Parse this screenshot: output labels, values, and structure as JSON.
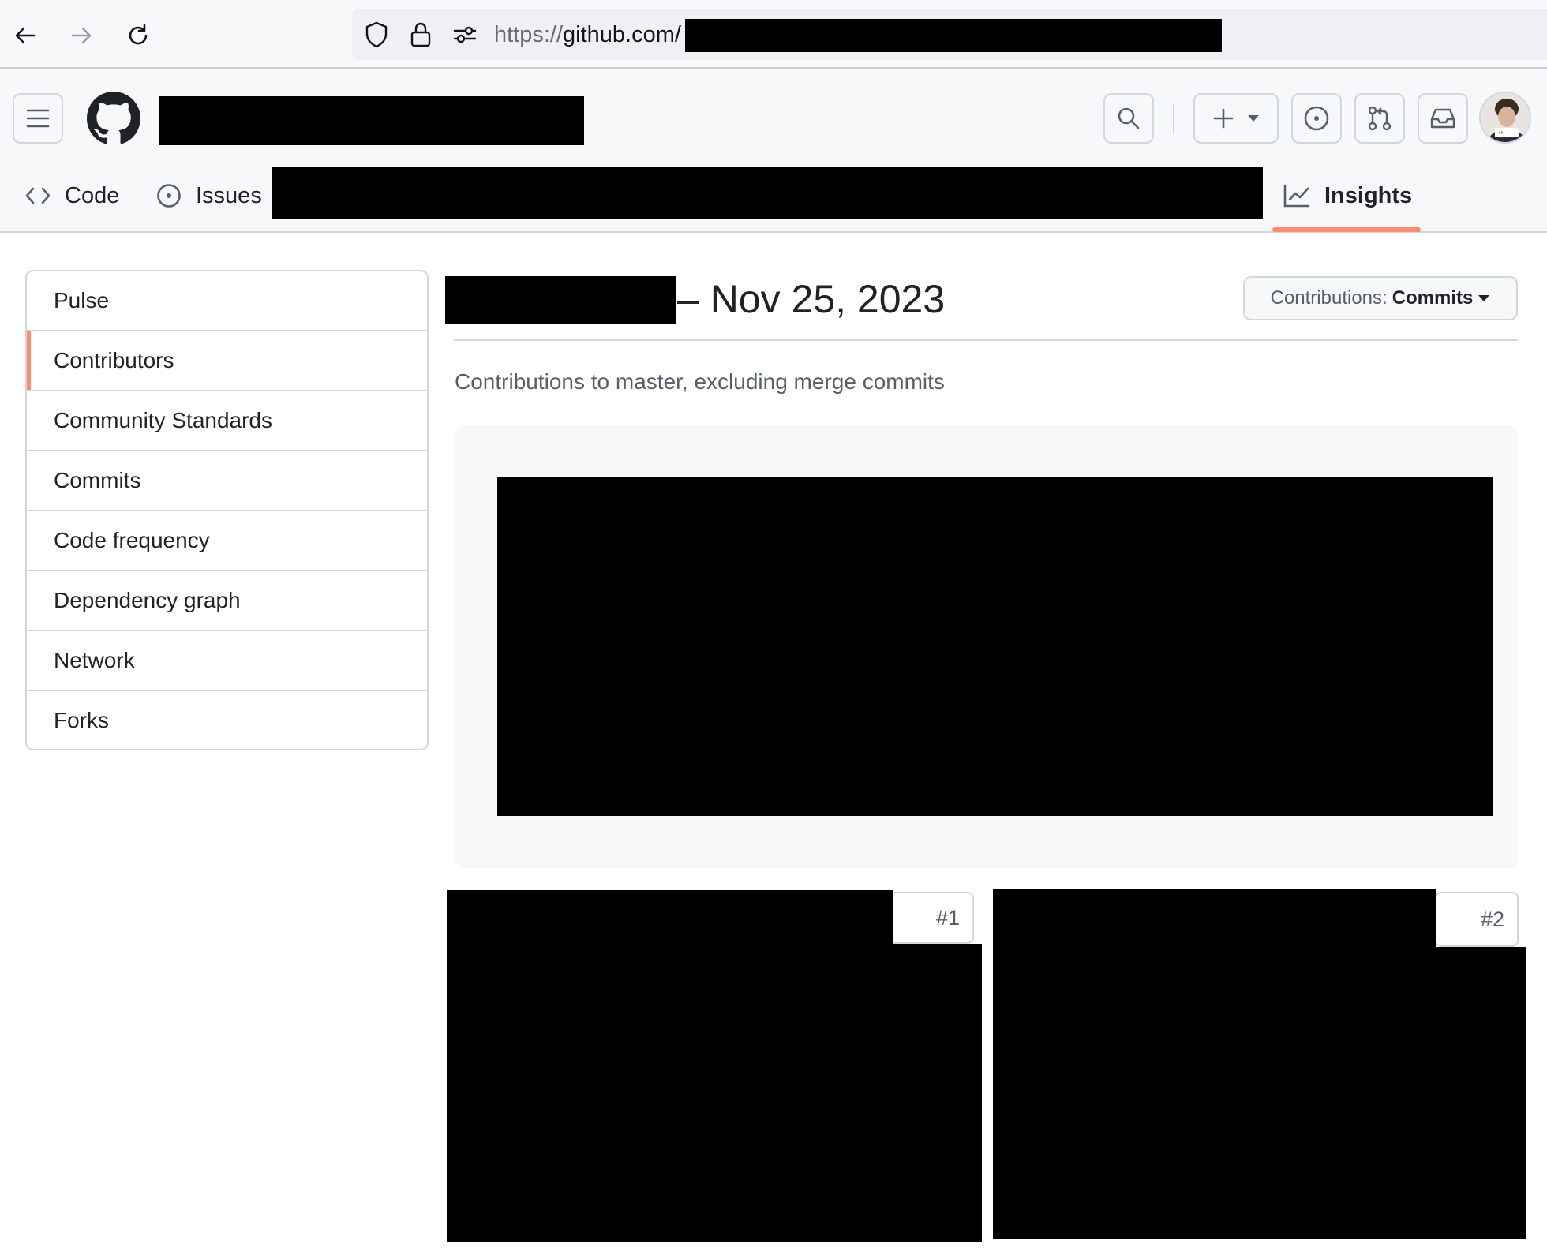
{
  "browser": {
    "url_scheme": "https://",
    "url_host": "github.com/",
    "icons": [
      "back-arrow-icon",
      "forward-arrow-icon",
      "reload-icon",
      "shield-icon",
      "lock-icon",
      "permissions-icon"
    ]
  },
  "repo_nav": {
    "tabs": [
      {
        "label": "Code",
        "icon": "code-icon"
      },
      {
        "label": "Issues",
        "icon": "issue-opened-icon"
      },
      {
        "label": "Insights",
        "icon": "graph-icon",
        "selected": true
      }
    ]
  },
  "sidebar": {
    "items": [
      {
        "label": "Pulse"
      },
      {
        "label": "Contributors",
        "selected": true
      },
      {
        "label": "Community Standards"
      },
      {
        "label": "Commits"
      },
      {
        "label": "Code frequency"
      },
      {
        "label": "Dependency graph"
      },
      {
        "label": "Network"
      },
      {
        "label": "Forks"
      }
    ]
  },
  "main": {
    "date_range_end": "– Nov 25, 2023",
    "contributions_label": "Contributions:",
    "contributions_value": "Commits",
    "subtitle": "Contributions to master, excluding merge commits",
    "cards": [
      {
        "rank": "#1"
      },
      {
        "rank": "#2"
      }
    ]
  },
  "colors": {
    "accent_underline": "#fd8c73",
    "border": "#d0d7de",
    "header_bg": "#f6f8fa",
    "muted_text": "#57606a",
    "redaction": "#000000"
  }
}
